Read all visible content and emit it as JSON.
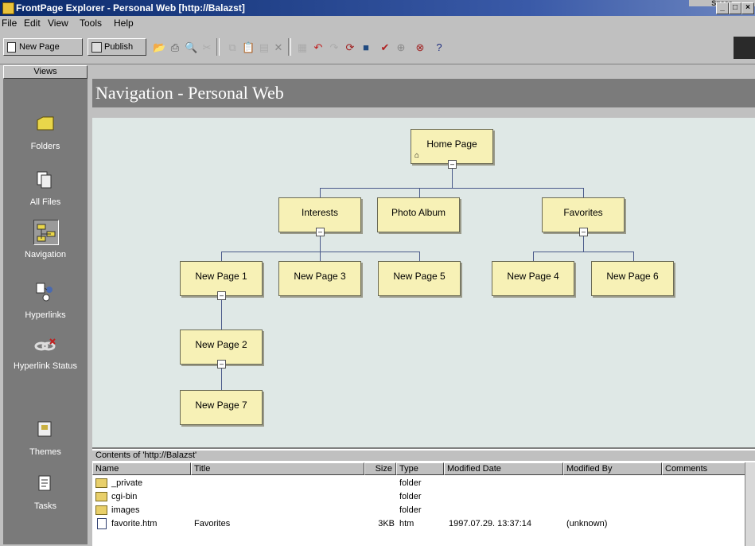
{
  "window": {
    "title": "FrontPage Explorer - Personal Web [http://Balazst]",
    "behind_badge": "Space",
    "controls": [
      "_",
      "□",
      "×"
    ]
  },
  "menu": [
    {
      "label": "File",
      "accel": "F"
    },
    {
      "label": "Edit",
      "accel": "E"
    },
    {
      "label": "View",
      "accel": "V"
    },
    {
      "label": "Tools",
      "accel": "T"
    },
    {
      "label": "Help",
      "accel": "H"
    }
  ],
  "toolbar": {
    "new_page_label": "New Page",
    "publish_label": "Publish",
    "icons": [
      "open-icon",
      "print-icon",
      "preview-icon",
      "cut-disabled-icon",
      "copy-disabled-icon",
      "paste-disabled-icon",
      "delete-icon",
      "properties-icon",
      "undo-icon",
      "redo-icon",
      "refresh-icon",
      "stop-icon",
      "spell-check-icon",
      "help-icon"
    ]
  },
  "views": {
    "header": "Views",
    "items": [
      {
        "label": "Folders",
        "icon": "folder-icon",
        "active": false
      },
      {
        "label": "All Files",
        "icon": "all-files-icon",
        "active": false
      },
      {
        "label": "Navigation",
        "icon": "navigation-icon",
        "active": true
      },
      {
        "label": "Hyperlinks",
        "icon": "hyperlinks-icon",
        "active": false
      },
      {
        "label": "Hyperlink Status",
        "icon": "hyperlink-status-icon",
        "active": false
      },
      {
        "label": "Themes",
        "icon": "themes-icon",
        "active": false
      },
      {
        "label": "Tasks",
        "icon": "tasks-icon",
        "active": false
      }
    ]
  },
  "main": {
    "title": "Navigation - Personal Web"
  },
  "nav_tree": {
    "home": "Home Page",
    "interests": "Interests",
    "photo_album": "Photo Album",
    "favorites": "Favorites",
    "np1": "New Page 1",
    "np3": "New Page 3",
    "np5": "New Page 5",
    "np4": "New Page 4",
    "np6": "New Page 6",
    "np2": "New Page 2",
    "np7": "New Page 7"
  },
  "contents": {
    "header": "Contents of 'http://Balazst'",
    "columns": [
      "Name",
      "Title",
      "Size",
      "Type",
      "Modified Date",
      "Modified By",
      "Comments"
    ],
    "rows": [
      {
        "name": "_private",
        "title": "",
        "size": "",
        "type": "folder",
        "date": "",
        "by": "",
        "kind": "folder"
      },
      {
        "name": "cgi-bin",
        "title": "",
        "size": "",
        "type": "folder",
        "date": "",
        "by": "",
        "kind": "folder"
      },
      {
        "name": "images",
        "title": "",
        "size": "",
        "type": "folder",
        "date": "",
        "by": "",
        "kind": "folder"
      },
      {
        "name": "favorite.htm",
        "title": "Favorites",
        "size": "3KB",
        "type": "htm",
        "date": "1997.07.29. 13:37:14",
        "by": "(unknown)",
        "kind": "file"
      }
    ]
  }
}
